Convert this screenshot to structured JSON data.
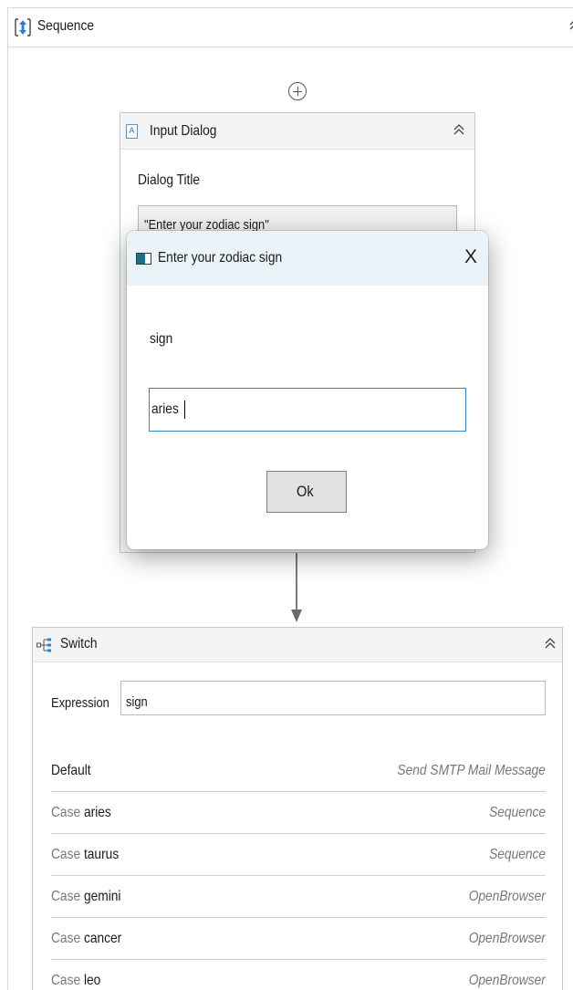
{
  "sequence": {
    "title": "Sequence",
    "collapse_icon": "double-chevron-up-icon"
  },
  "add_activity_icon": "plus-circle-icon",
  "input_dialog_activity": {
    "title": "Input Dialog",
    "field_label": "Dialog Title",
    "field_value": "\"Enter your zodiac sign\""
  },
  "popup": {
    "title": "Enter your zodiac sign",
    "close_label": "X",
    "label": "sign",
    "input_value": "aries",
    "ok_label": "Ok"
  },
  "switch_activity": {
    "title": "Switch",
    "expression_label": "Expression",
    "expression_value": "sign",
    "rows": [
      {
        "keyword": "",
        "value": "Default",
        "activity": "Send SMTP Mail Message"
      },
      {
        "keyword": "Case",
        "value": "aries",
        "activity": "Sequence"
      },
      {
        "keyword": "Case",
        "value": "taurus",
        "activity": "Sequence"
      },
      {
        "keyword": "Case",
        "value": "gemini",
        "activity": "OpenBrowser"
      },
      {
        "keyword": "Case",
        "value": "cancer",
        "activity": "OpenBrowser"
      },
      {
        "keyword": "Case",
        "value": "leo",
        "activity": "OpenBrowser"
      }
    ]
  },
  "colors": {
    "accent": "#2e86c8",
    "dialog_header": "#eaf3f8",
    "card_header": "#f4f4f4"
  }
}
